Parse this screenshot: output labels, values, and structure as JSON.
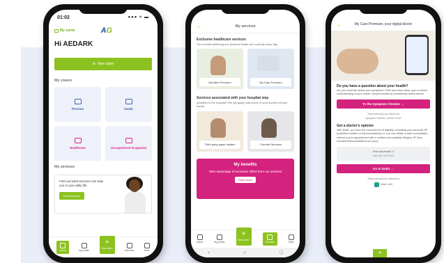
{
  "phone1": {
    "time": "01:02",
    "signal": "●●● ≈ ▬",
    "my_cards": "My cards",
    "logo_a": "A",
    "logo_g": "G",
    "greeting": "Hi AEDARK",
    "new_claim": "New claim",
    "my_covers": "My covers",
    "covers": [
      {
        "label": "Pension"
      },
      {
        "label": "Death"
      },
      {
        "label": "Healthcare"
      },
      {
        "label": "Occupational incapacity"
      }
    ],
    "my_services": "My services",
    "services_text": "Find out what services can help you in your daily life",
    "find_out_more": "Find out more",
    "tabs": {
      "home": "Home",
      "profile": "My profile",
      "plus_symbol": "+",
      "plus": "New claim",
      "services": "Services",
      "more": "More"
    }
  },
  "phone2": {
    "title": "My services",
    "back": "←",
    "exclusive_title": "Exclusive healthcare services",
    "exclusive_sub": "Your mental wellbeing and physical health are a priority every day",
    "tiles1": [
      {
        "label": "My Mind Premium"
      },
      {
        "label": "My Care Premium"
      }
    ],
    "hospital_title": "Services associated with your hospital stay",
    "hospital_sub": "Admitted to the hospital? We will gladly take some of your worries off your hands.",
    "tiles2": [
      {
        "label": "Third party payer system"
      },
      {
        "label": "Comfort Services"
      }
    ],
    "benefits_title": "My benefits",
    "benefits_desc": "Take advantage of exclusive offers from our partners",
    "benefits_btn": "Read more",
    "tabs": {
      "home": "Home",
      "profile": "My profile",
      "plus_symbol": "+",
      "plus": "New claim",
      "services": "Services",
      "more": "More"
    },
    "nav": [
      "‹",
      "○",
      "□"
    ]
  },
  "phone3": {
    "title": "My Care Premium, your digital doctor",
    "back": "←",
    "q_title": "Do you have a question about your health?",
    "q_text": "Are you uncertain about your symptoms? With just a few clicks, gain a clearer understanding of your health, complemented by scientifically based advice.",
    "checker_btn": "To the Symptom Checker →",
    "offered_by": "These services are offered by",
    "offered_sub": "Symptom Checker, partner of AG",
    "doctor_title": "Get a doctor's opinion",
    "doctor_text": "With Doktr, you have the convenience of digitally consulting your personal GP (unlimited number of teleconsultations) or you can initiate a video consultation without a prior appointment with a certified and available Belgian GP (two included teleconsultations per year).",
    "free_label": "Free accesskit: 0",
    "free_sub": "Valid until: 31/12/2024",
    "doktr_btn": "Go to Doktr →",
    "offered_by2": "These services are offered by",
    "brand": "Doktr × AG",
    "plus": "+"
  }
}
